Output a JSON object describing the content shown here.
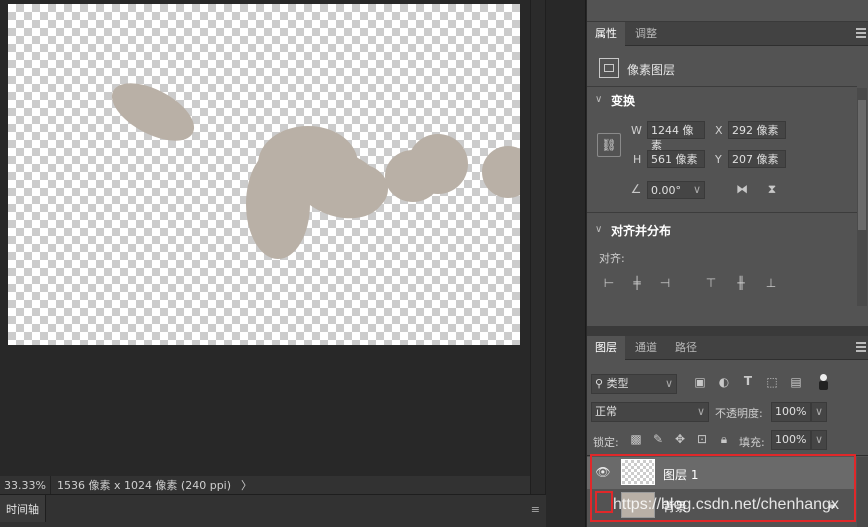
{
  "status_bar": {
    "zoom": "33.33%",
    "doc_info": "1536 像素 x 1024 像素 (240 ppi)",
    "arrow": "〉"
  },
  "timeline": {
    "tab_label": "时间轴"
  },
  "properties_panel": {
    "tabs": [
      "属性",
      "调整"
    ],
    "layer_type_label": "像素图层",
    "transform": {
      "title": "变换",
      "w_label": "W",
      "w_value": "1244 像素",
      "x_label": "X",
      "x_value": "292 像素",
      "h_label": "H",
      "h_value": "561 像素",
      "y_label": "Y",
      "y_value": "207 像素",
      "angle_value": "0.00°"
    },
    "align": {
      "title": "对齐并分布",
      "align_label": "对齐:"
    }
  },
  "layers_panel": {
    "tabs": [
      "图层",
      "通道",
      "路径"
    ],
    "filter_kind": "类型",
    "blend_mode": "正常",
    "opacity_label": "不透明度:",
    "opacity_value": "100%",
    "lock_label": "锁定:",
    "fill_label": "填充:",
    "fill_value": "100%",
    "layers": [
      {
        "name": "图层 1",
        "visible": true,
        "selected": true
      },
      {
        "name": "背景",
        "visible": false,
        "selected": false,
        "locked": true
      }
    ]
  },
  "watermark": "https://blog.csdn.net/chenhangx",
  "colors": {
    "accent_highlight": "#e0282a",
    "blob": "#b9b0a6",
    "panel_bg": "#535353",
    "app_bg": "#282828"
  }
}
